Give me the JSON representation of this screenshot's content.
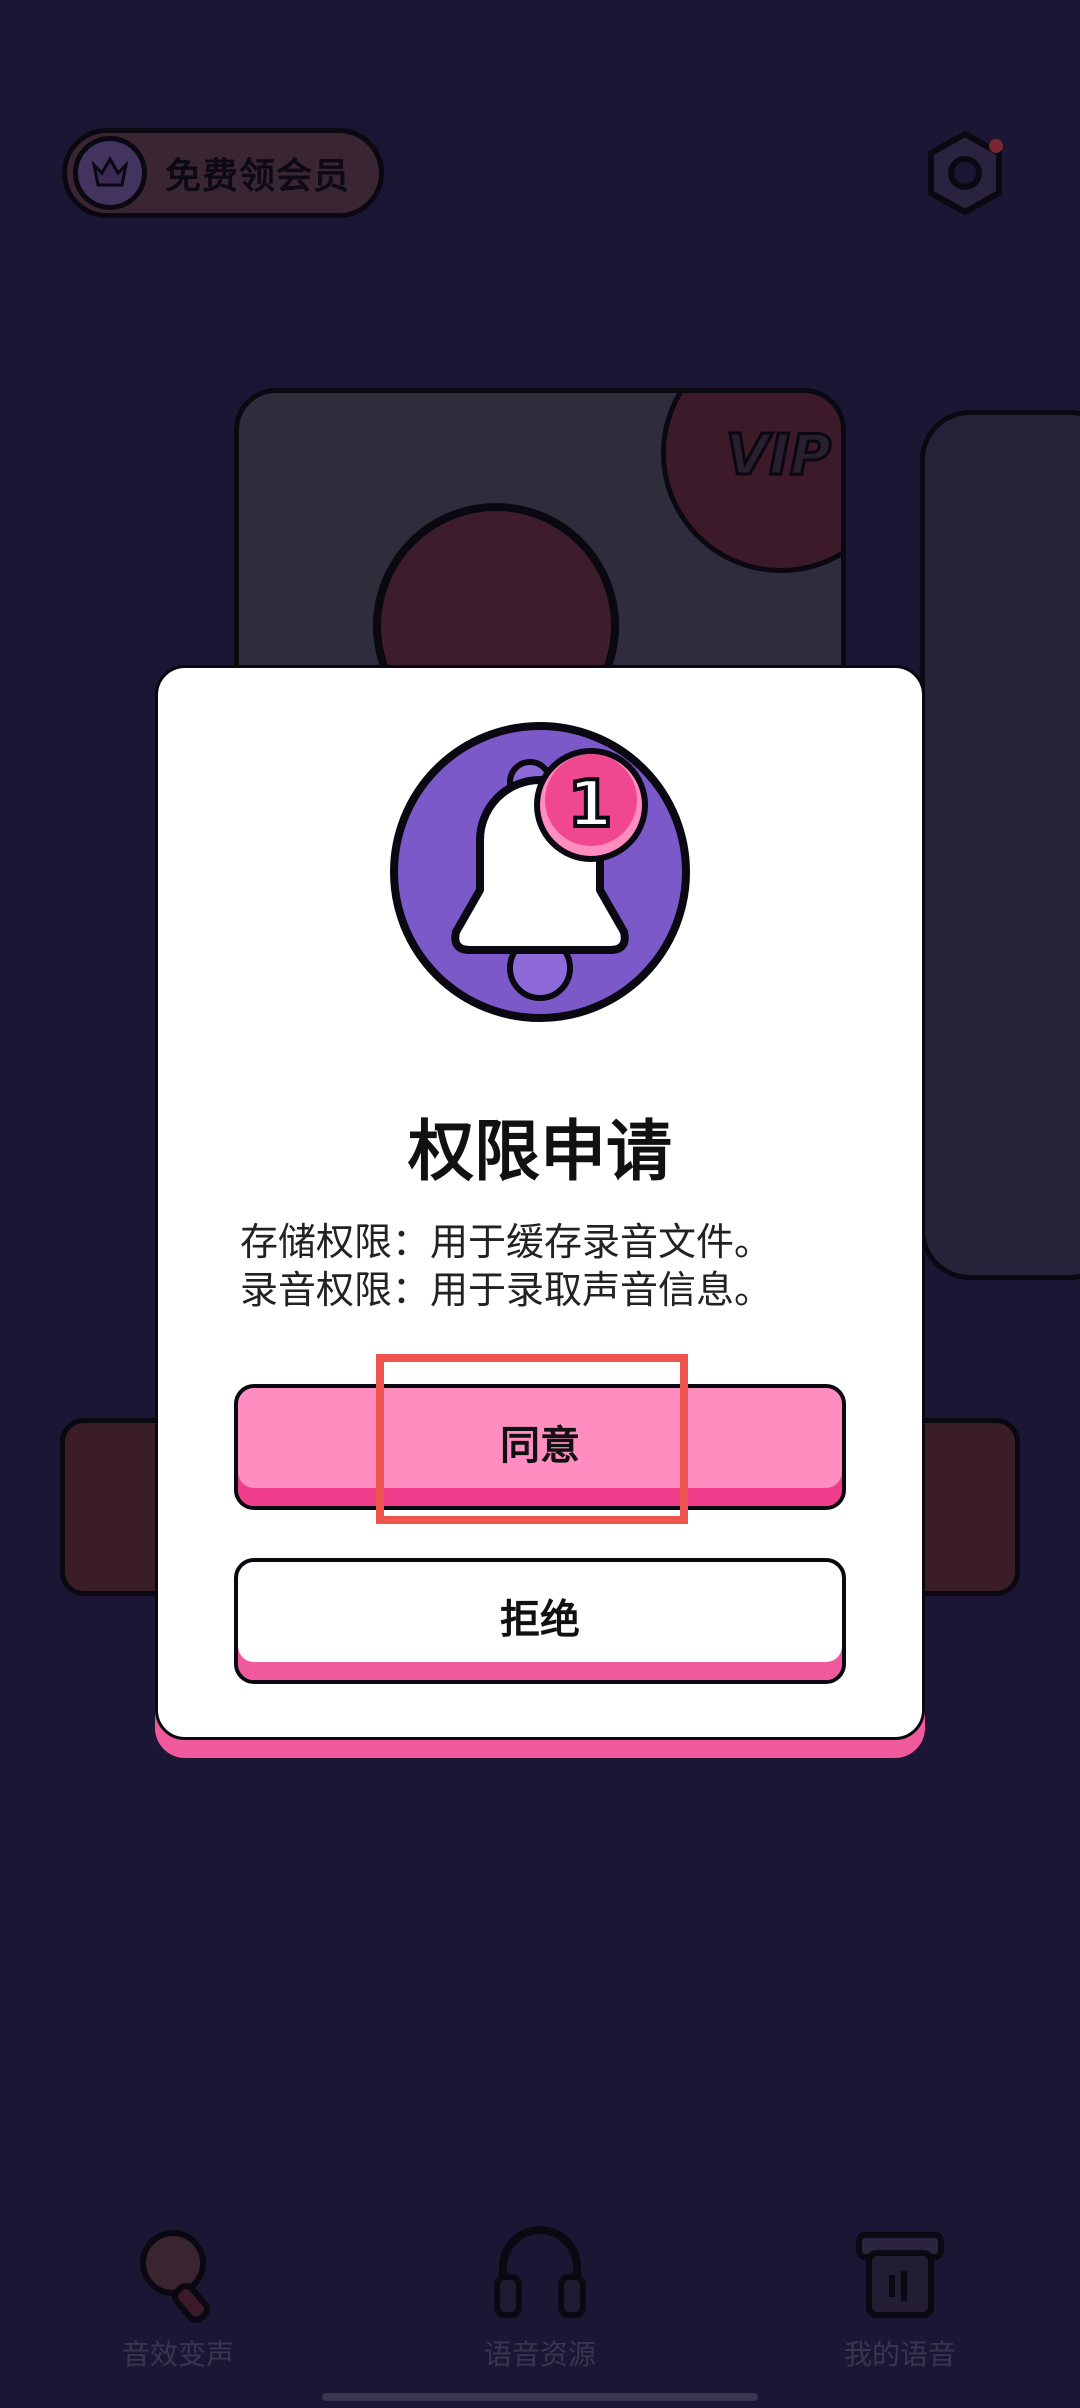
{
  "topbar": {
    "vip_label": "免费领会员"
  },
  "background_card": {
    "badge": "VIP"
  },
  "dialog": {
    "title": "权限申请",
    "lines": [
      "存储权限：用于缓存录音文件。",
      "录音权限：用于录取声音信息。"
    ],
    "notification_count": "1",
    "agree_label": "同意",
    "reject_label": "拒绝"
  },
  "bottom_nav": {
    "items": [
      {
        "label": "音效变声",
        "icon": "microphone-icon"
      },
      {
        "label": "语音资源",
        "icon": "headphones-icon"
      },
      {
        "label": "我的语音",
        "icon": "voice-box-icon"
      }
    ]
  },
  "colors": {
    "background": "#1b1633",
    "accent_pink": "#ff8dbf",
    "accent_purple": "#7b59c9",
    "highlight_red": "#f0544f"
  }
}
